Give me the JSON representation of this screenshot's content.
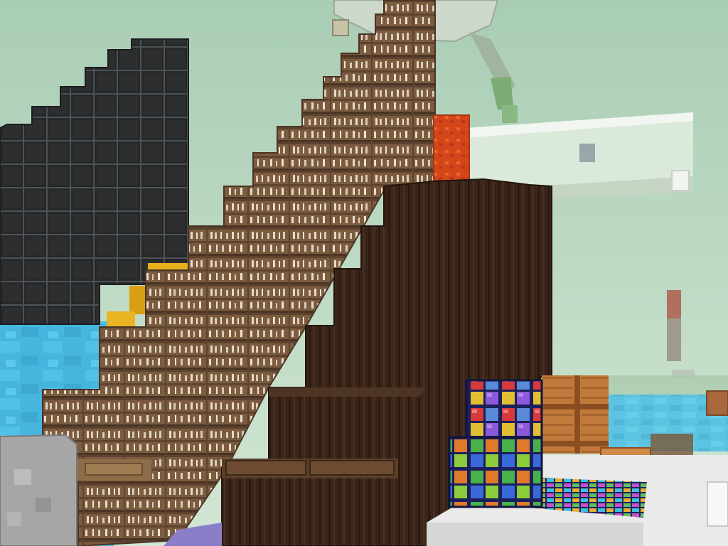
{
  "scene": {
    "kind": "voxel-sandbox-world",
    "hud_text": [],
    "objects": [
      {
        "name": "sky",
        "color": "#bcd9c0"
      },
      {
        "name": "water",
        "color": "#48b8e0"
      },
      {
        "name": "black-grid-staircase",
        "color": "#2a2c2e"
      },
      {
        "name": "bookshelf-staircase",
        "color": "#8a6a4a"
      },
      {
        "name": "dark-log-staircase",
        "color": "#3a2418"
      },
      {
        "name": "rainbow-block-steps",
        "color": "#4a5ad0"
      },
      {
        "name": "wooden-crates",
        "color": "#c07838"
      },
      {
        "name": "red-lava-block",
        "color": "#d24a1a"
      },
      {
        "name": "white-floating-platform",
        "color": "#e2ecdf"
      },
      {
        "name": "white-floor-slab",
        "color": "#eaeaea"
      },
      {
        "name": "gray-stone-block",
        "color": "#a8a8a8"
      },
      {
        "name": "floating-pillar",
        "color": "#9a7060"
      }
    ]
  }
}
